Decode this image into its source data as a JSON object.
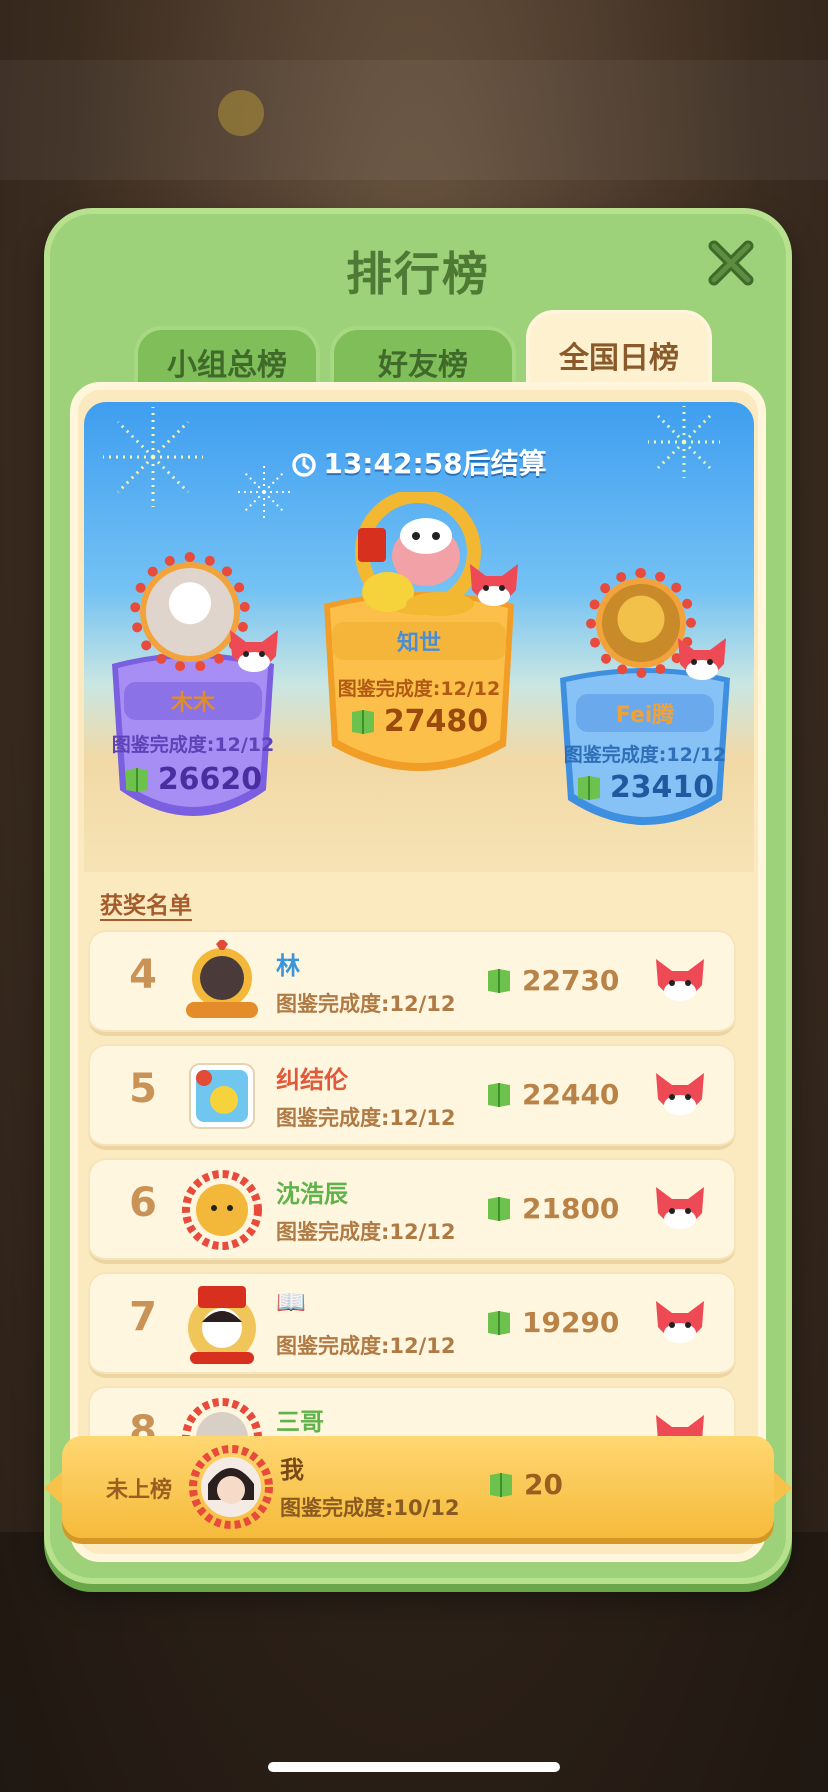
{
  "panel": {
    "title": "排行榜"
  },
  "tabs": [
    {
      "label": "小组总榜",
      "active": false
    },
    {
      "label": "好友榜",
      "active": false
    },
    {
      "label": "全国日榜",
      "active": true
    }
  ],
  "timer": {
    "time": "13:42:58",
    "suffix": "后结算"
  },
  "podium": {
    "first": {
      "name": "知世",
      "complete": "图鉴完成度:12/12",
      "score": "27480"
    },
    "second": {
      "name": "木木",
      "complete": "图鉴完成度:12/12",
      "score": "26620"
    },
    "third": {
      "name": "Fei腾",
      "complete": "图鉴完成度:12/12",
      "score": "23410"
    }
  },
  "winners_label": "获奖名单",
  "rows": [
    {
      "rank": "4",
      "name": "林",
      "name_color": "#3c95d8",
      "complete": "图鉴完成度:12/12",
      "score": "22730"
    },
    {
      "rank": "5",
      "name": "纠结伦",
      "name_color": "#e05a3a",
      "complete": "图鉴完成度:12/12",
      "score": "22440"
    },
    {
      "rank": "6",
      "name": "沈浩辰",
      "name_color": "#5fb34a",
      "complete": "图鉴完成度:12/12",
      "score": "21800"
    },
    {
      "rank": "7",
      "name": "📖",
      "name_color": "#5fb34a",
      "complete": "图鉴完成度:12/12",
      "score": "19290"
    },
    {
      "rank": "8",
      "name": "三哥",
      "name_color": "#5fb34a",
      "complete": "",
      "score": ""
    }
  ],
  "self": {
    "status": "未上榜",
    "name": "我",
    "complete": "图鉴完成度:10/12",
    "score": "20"
  },
  "colors": {
    "panel_green": "#9ed27a",
    "cream": "#fbe9bf",
    "gold": "#f5bb3b",
    "score_brown": "#b98347"
  }
}
